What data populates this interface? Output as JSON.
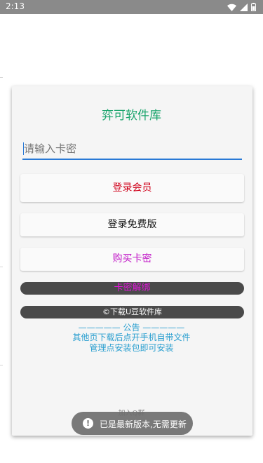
{
  "status_bar": {
    "time": "2:13",
    "icons": [
      "wifi-icon",
      "signal-icon",
      "battery-icon"
    ]
  },
  "dialog": {
    "title": "弈可软件库",
    "card_input": {
      "value": "",
      "placeholder": "请输入卡密"
    },
    "buttons": {
      "login_member": "登录会员",
      "login_free": "登录免费版",
      "buy_card": "购买卡密",
      "unbind_card": "卡密解绑",
      "download": "©下载U豆软件库"
    },
    "notice": {
      "heading": "————— 公告 —————",
      "line1": "其他页下载后点开手机自带文件",
      "line2": "管理点安装包即可安装"
    },
    "join_group": "加入Q群"
  },
  "toast": {
    "icon": "info-icon",
    "message": "已是最新版本,无需更新"
  },
  "colors": {
    "title": "#1aa56d",
    "accent": "#2979d6",
    "member": "#d0021b",
    "buy": "#c21cc8",
    "notice": "#2a9fd0"
  }
}
